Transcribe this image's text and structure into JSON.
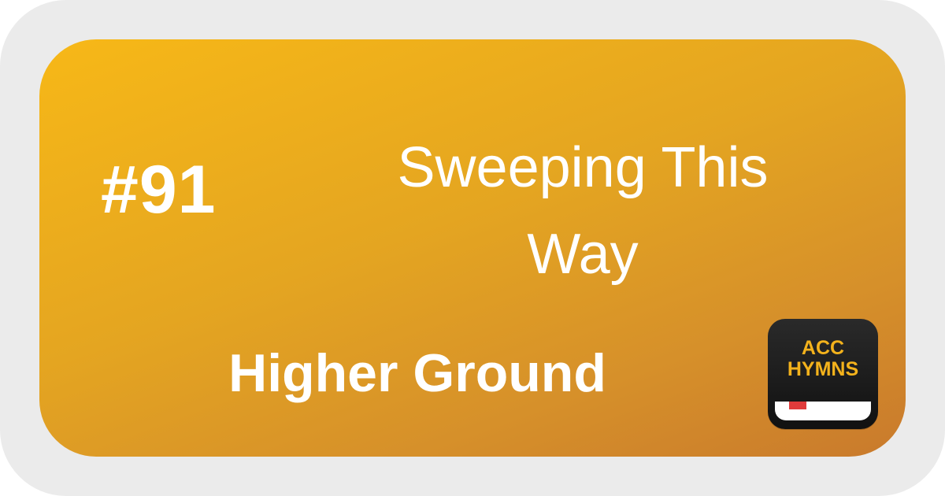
{
  "hymn": {
    "number": "#91",
    "title_line1": "Sweeping This",
    "title_line2": "Way",
    "tune": "Higher Ground"
  },
  "app_icon": {
    "line1": "ACC",
    "line2": "HYMNS",
    "icon_name": "acc-hymns-app-icon"
  },
  "colors": {
    "background": "#ebebeb",
    "card_gradient_start": "#f7b817",
    "card_gradient_end": "#c97a2c",
    "text": "#ffffff",
    "icon_bg": "#1a1a1a",
    "icon_text": "#f3b21c",
    "bookmark": "#e03b3b"
  }
}
